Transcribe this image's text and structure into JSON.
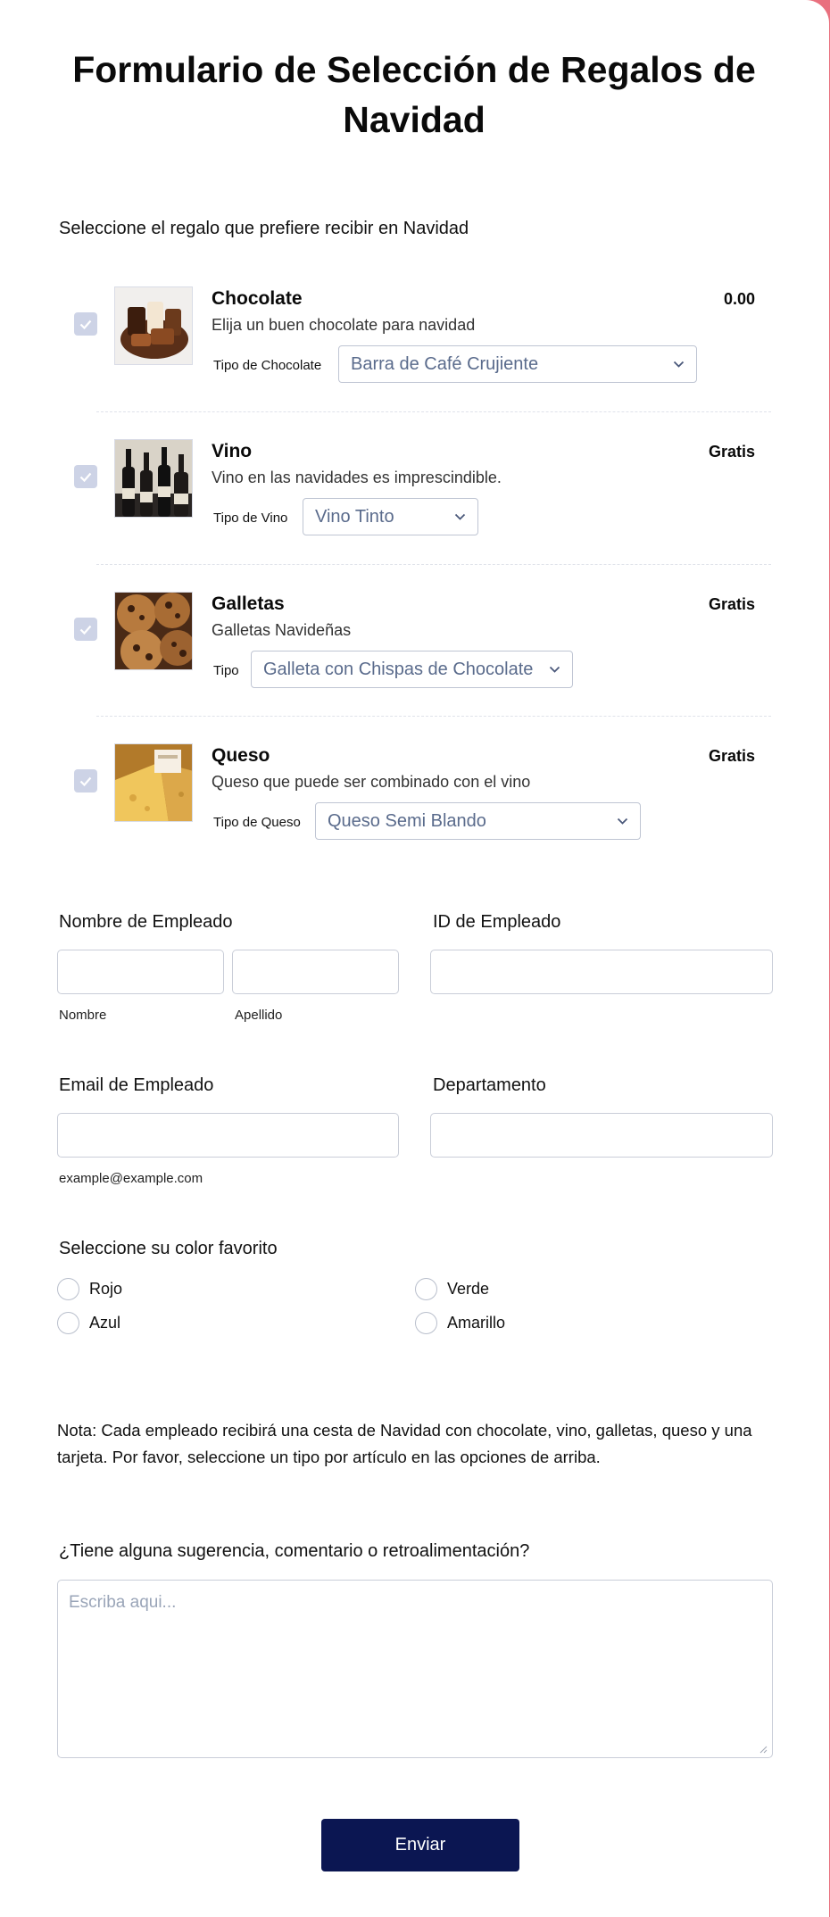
{
  "form": {
    "title": "Formulario de Selección de Regalos de Navidad",
    "products_label": "Seleccione el regalo que prefiere recibir en Navidad",
    "products": [
      {
        "name": "Chocolate",
        "description": "Elija un buen chocolate para navidad",
        "price": "0.00",
        "option_label": "Tipo de Chocolate",
        "option_value": "Barra de Café Crujiente",
        "checked": true
      },
      {
        "name": "Vino",
        "description": "Vino en las navidades es imprescindible.",
        "price": "Gratis",
        "option_label": "Tipo de Vino",
        "option_value": "Vino Tinto",
        "checked": true
      },
      {
        "name": "Galletas",
        "description": "Galletas Navideñas",
        "price": "Gratis",
        "option_label": "Tipo",
        "option_value": "Galleta con Chispas de Chocolate",
        "checked": true
      },
      {
        "name": "Queso",
        "description": "Queso que puede ser combinado con el vino",
        "price": "Gratis",
        "option_label": "Tipo de Queso",
        "option_value": "Queso Semi Blando",
        "checked": true
      }
    ],
    "employee_name": {
      "label": "Nombre de Empleado",
      "first": "Nombre",
      "last": "Apellido"
    },
    "employee_id": {
      "label": "ID de Empleado"
    },
    "employee_email": {
      "label": "Email de Empleado",
      "hint": "example@example.com"
    },
    "department": {
      "label": "Departamento"
    },
    "color": {
      "label": "Seleccione su color favorito",
      "options": [
        "Rojo",
        "Verde",
        "Azul",
        "Amarillo"
      ]
    },
    "note": "Nota: Cada empleado recibirá una cesta de Navidad con chocolate, vino, galletas, queso y una tarjeta. Por favor, seleccione un tipo por artículo en las opciones de arriba.",
    "feedback": {
      "label": "¿Tiene alguna sugerencia, comentario o retroalimentación?",
      "placeholder": "Escriba aqui..."
    },
    "submit_label": "Enviar"
  },
  "colors": {
    "page_bg": "#e9707e",
    "button": "#0b1652",
    "checkbox": "#cdd3e6"
  }
}
